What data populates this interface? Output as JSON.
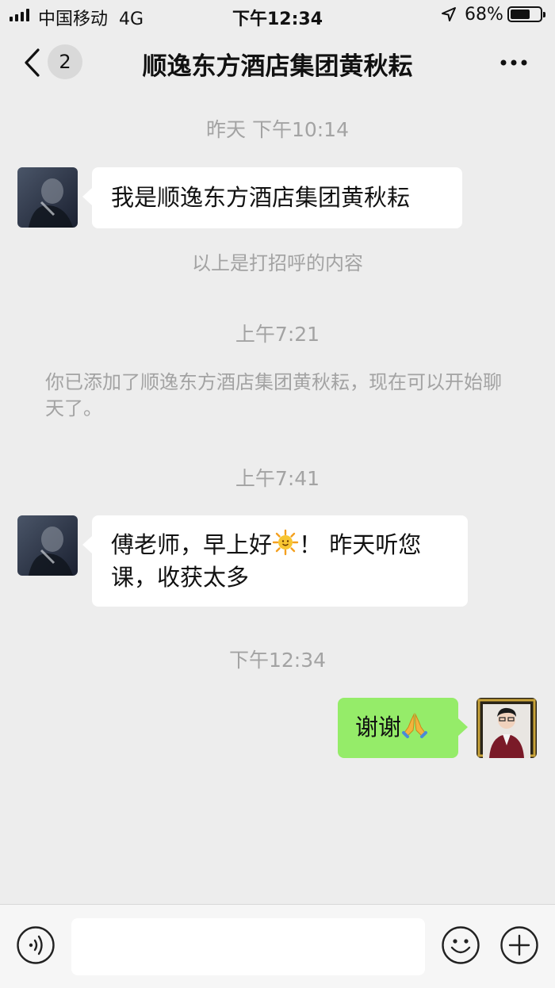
{
  "status": {
    "carrier": "中国移动",
    "network": "4G",
    "time": "下午12:34",
    "battery": "68%",
    "battery_level": 0.68
  },
  "nav": {
    "back_badge": "2",
    "title": "顺逸东方酒店集团黄秋耘"
  },
  "chat": {
    "ts1": "昨天 下午10:14",
    "msg1": "我是顺逸东方酒店集团黄秋耘",
    "sys1": "以上是打招呼的内容",
    "ts2": "上午7:21",
    "sys2": "你已添加了顺逸东方酒店集团黄秋耘，现在可以开始聊天了。",
    "ts3": "上午7:41",
    "msg2_a": "傅老师，早上好",
    "msg2_b": "！ 昨天听您课，收获太多",
    "ts4": "下午12:34",
    "msg3": "谢谢"
  },
  "colors": {
    "background": "#ededed",
    "self_bubble": "#95ec69",
    "other_bubble": "#ffffff",
    "meta_text": "#a3a3a3"
  },
  "icons": [
    "signal-icon",
    "location-arrow-icon",
    "battery-icon",
    "back-chevron-icon",
    "more-icon",
    "sun-emoji-icon",
    "pray-emoji-icon",
    "voice-icon",
    "emoji-face-icon",
    "plus-icon"
  ]
}
